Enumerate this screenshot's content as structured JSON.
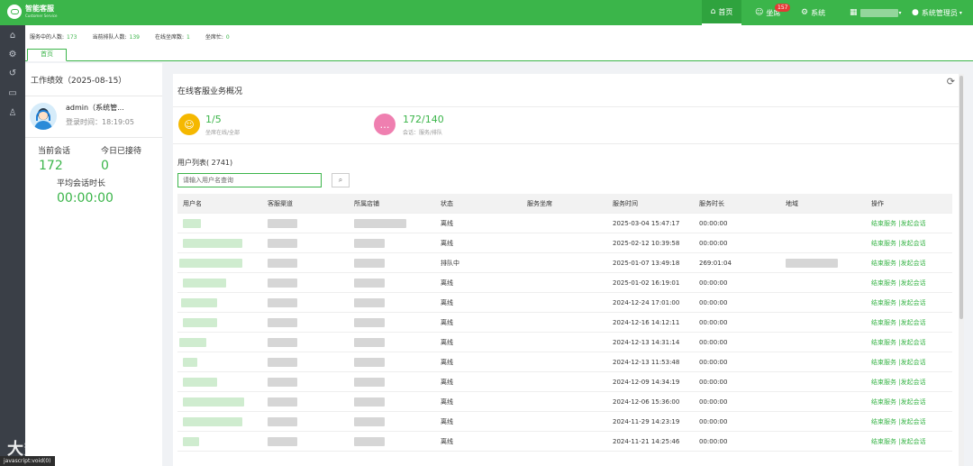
{
  "app": {
    "title": "智能客服",
    "subtitle": "Customer Service"
  },
  "nav": {
    "home": "首页",
    "seat": "坐席",
    "seat_badge": "157",
    "system": "系统",
    "user": "系统管理员"
  },
  "stats": {
    "in_service_label": "服务中的人数:",
    "in_service_value": "173",
    "queue_label": "当前排队人数:",
    "queue_value": "139",
    "online_label": "在线坐席数:",
    "online_value": "1",
    "busy_label": "坐席忙:",
    "busy_value": "0"
  },
  "tabs": [
    "首页"
  ],
  "left_panel": {
    "title": "工作绩效（2025-08-15）",
    "user_name": "admin（系统管...",
    "login_time": "登录时间：18:19:05",
    "current_session_label": "当前会话",
    "current_session_value": "172",
    "today_received_label": "今日已接待",
    "today_received_value": "0",
    "avg_duration_label": "平均会话时长",
    "avg_duration_value": "00:00:00"
  },
  "overview": {
    "title": "在线客服业务概况",
    "seats_value": "1/5",
    "seats_label": "坐席在线/全部",
    "sessions_value": "172/140",
    "sessions_label": "会话：服务/排队"
  },
  "user_list": {
    "title": "用户列表( 2741)",
    "search_placeholder": "请输入用户名查询",
    "columns": [
      "用户名",
      "客服渠道",
      "所属店铺",
      "状态",
      "服务坐席",
      "服务时间",
      "服务时长",
      "地域",
      "操作"
    ],
    "action_label": "结束服务 |发起会话",
    "rows": [
      {
        "status": "离线",
        "time": "2025-03-04 15:47:17",
        "duration": "00:00:00"
      },
      {
        "status": "离线",
        "time": "2025-02-12 10:39:58",
        "duration": "00:00:00"
      },
      {
        "status": "排队中",
        "time": "2025-01-07 13:49:18",
        "duration": "269:01:04"
      },
      {
        "status": "离线",
        "time": "2025-01-02 16:19:01",
        "duration": "00:00:00"
      },
      {
        "status": "离线",
        "time": "2024-12-24 17:01:00",
        "duration": "00:00:00"
      },
      {
        "status": "离线",
        "time": "2024-12-16 14:12:11",
        "duration": "00:00:00"
      },
      {
        "status": "离线",
        "time": "2024-12-13 14:31:14",
        "duration": "00:00:00"
      },
      {
        "status": "离线",
        "time": "2024-12-13 11:53:48",
        "duration": "00:00:00"
      },
      {
        "status": "离线",
        "time": "2024-12-09 14:34:19",
        "duration": "00:00:00"
      },
      {
        "status": "离线",
        "time": "2024-12-06 15:36:00",
        "duration": "00:00:00"
      },
      {
        "status": "离线",
        "time": "2024-11-29 14:23:19",
        "duration": "00:00:00"
      },
      {
        "status": "离线",
        "time": "2024-11-21 14:25:46",
        "duration": "00:00:00"
      }
    ]
  },
  "watermark": "大数跨境",
  "status_bar": "javascript:void(0)",
  "colors": {
    "brand": "#3bb54a",
    "sidebar": "#3a3f47",
    "seat_icon": "#f5b800",
    "session_icon": "#ef7fb0"
  },
  "icons": [
    "home-icon",
    "user-icon",
    "gear-icon",
    "building-icon",
    "refresh-icon",
    "search-icon",
    "history-icon",
    "monitor-icon",
    "people-icon"
  ]
}
